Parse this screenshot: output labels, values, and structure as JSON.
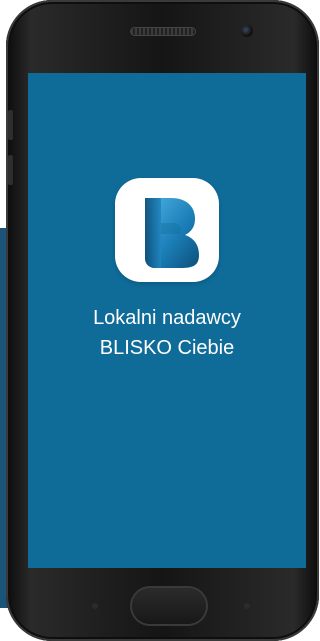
{
  "splash": {
    "tagline_line1": "Lokalni nadawcy",
    "tagline_line2": "BLISKO Ciebie"
  },
  "app_icon": {
    "name": "blisko-b-logo-icon",
    "color_light": "#4db3e4",
    "color_dark": "#0c4f7a"
  },
  "colors": {
    "screen_background": "#0f6b98",
    "background_panel": "#1b5479",
    "text": "#ffffff"
  }
}
